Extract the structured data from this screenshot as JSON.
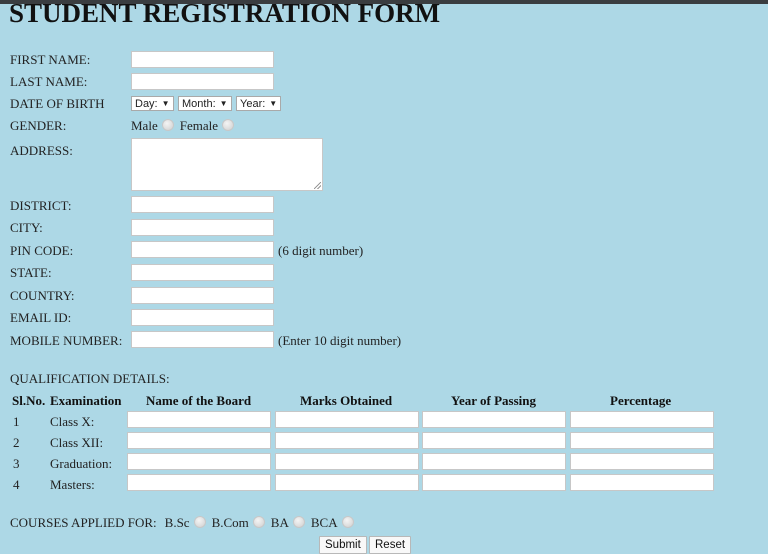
{
  "page": {
    "title": "STUDENT REGISTRATION FORM",
    "background_color": "#ADD8E6"
  },
  "form": {
    "first_name": {
      "label": "FIRST NAME:",
      "value": ""
    },
    "last_name": {
      "label": "LAST NAME:",
      "value": ""
    },
    "dob": {
      "label": "DATE OF BIRTH",
      "day": "Day:",
      "month": "Month:",
      "year": "Year:"
    },
    "gender": {
      "label": "GENDER:",
      "options": [
        "Male",
        "Female"
      ],
      "selected": null
    },
    "address": {
      "label": "ADDRESS:",
      "value": ""
    },
    "district": {
      "label": "DISTRICT:",
      "value": ""
    },
    "city": {
      "label": "CITY:",
      "value": ""
    },
    "pin_code": {
      "label": "PIN CODE:",
      "value": "",
      "hint": "(6 digit number)"
    },
    "state": {
      "label": "STATE:",
      "value": ""
    },
    "country": {
      "label": "COUNTRY:",
      "value": ""
    },
    "email": {
      "label": "EMAIL ID:",
      "value": ""
    },
    "mobile": {
      "label": "MOBILE NUMBER:",
      "value": "",
      "hint": "(Enter 10 digit number)"
    }
  },
  "qualification": {
    "title": "QUALIFICATION DETAILS:",
    "headers": [
      "Sl.No.",
      "Examination",
      "Name of the Board",
      "Marks Obtained",
      "Year of Passing",
      "Percentage"
    ],
    "rows": [
      {
        "sl": "1",
        "exam": "Class X:"
      },
      {
        "sl": "2",
        "exam": "Class XII:"
      },
      {
        "sl": "3",
        "exam": "Graduation:"
      },
      {
        "sl": "4",
        "exam": "Masters:"
      }
    ]
  },
  "courses": {
    "label": "COURSES APPLIED FOR:",
    "options": [
      "B.Sc",
      "B.Com",
      "BA",
      "BCA"
    ],
    "selected": null
  },
  "buttons": {
    "submit": "Submit",
    "reset": "Reset"
  }
}
